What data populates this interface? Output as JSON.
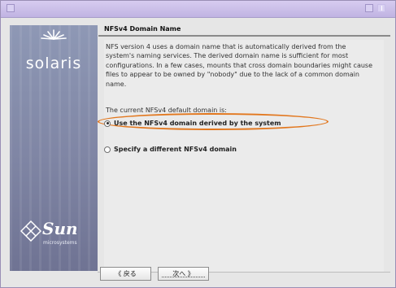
{
  "brand": {
    "product_logo": "solaris",
    "vendor_logo": "Sun",
    "vendor_sub": "microsystems"
  },
  "content": {
    "heading": "NFSv4 Domain Name",
    "description": "NFS version 4 uses a domain name that is automatically derived from the system's naming services. The derived domain name is sufficient for most configurations. In a few cases, mounts that cross domain boundaries might cause files to appear to be owned by \"nobody\" due to the lack of a common domain name.",
    "current_label": "The current NFSv4 default domain is:",
    "options": [
      {
        "label": "Use the NFSv4 domain derived by the system",
        "selected": true
      },
      {
        "label": "Specify a different NFSv4 domain",
        "selected": false
      }
    ]
  },
  "buttons": {
    "back": "《 戻る",
    "next": "次へ 》"
  },
  "colors": {
    "highlight": "#e2771e",
    "titlebar": "#c9bfe8",
    "sidepanel": "#7f85a4"
  }
}
